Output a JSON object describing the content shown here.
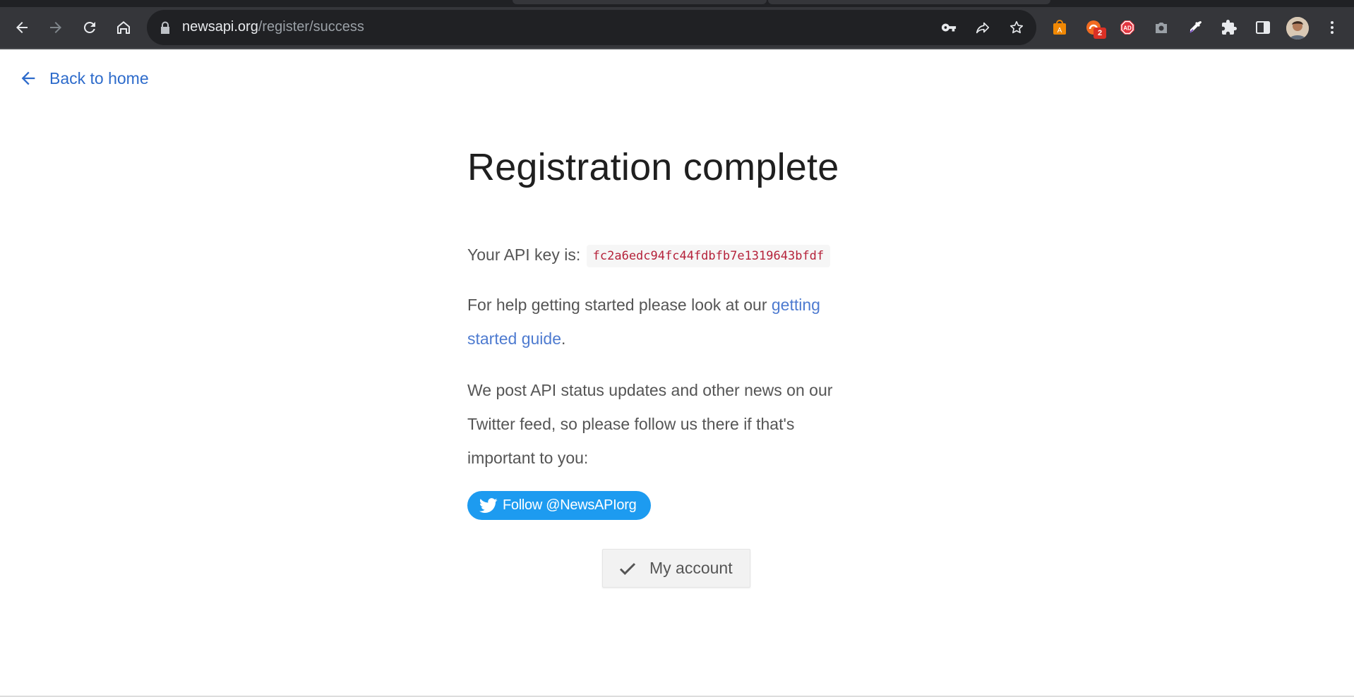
{
  "browser": {
    "url_host": "newsapi.org",
    "url_path": "/register/success",
    "extensions": [
      {
        "name": "amazon-assistant-icon",
        "color": "#f08804"
      },
      {
        "name": "honey-extension-icon",
        "color": "#f26c21",
        "badge": "2"
      },
      {
        "name": "adblock-icon",
        "color": "#e3343f"
      },
      {
        "name": "screenshot-camera-icon",
        "color": "#9aa0a6"
      },
      {
        "name": "color-picker-icon",
        "color": "#ffffff"
      },
      {
        "name": "extensions-puzzle-icon",
        "color": "#e8eaed"
      },
      {
        "name": "side-panel-icon",
        "color": "#e8eaed"
      }
    ]
  },
  "page": {
    "back_link": "Back to home",
    "title": "Registration complete",
    "api_key_label": "Your API key is:",
    "api_key": "fc2a6edc94fc44fdbfb7e1319643bfdf",
    "help_text_before": "For help getting started please look at our ",
    "help_link": "getting started guide",
    "help_text_after": ".",
    "twitter_text": "We post API status updates and other news on our Twitter feed, so please follow us there if that's important to you:",
    "twitter_button": "Follow @NewsAPIorg",
    "account_button": "My account"
  },
  "colors": {
    "link_blue": "#2d6bcb",
    "twitter_blue": "#1d9bf0",
    "api_key_red": "#b5223a"
  }
}
